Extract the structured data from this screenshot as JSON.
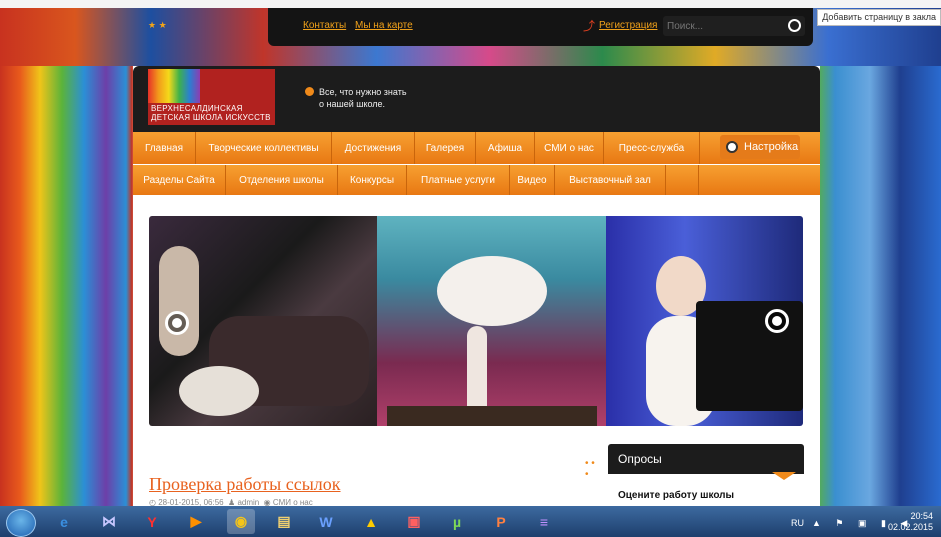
{
  "browser": {
    "bookmark_label": "Добавить страницу в закла"
  },
  "topbar": {
    "links": [
      "Контакты",
      "Мы на карте"
    ],
    "register": "Регистрация",
    "search_placeholder": "Поиск..."
  },
  "header": {
    "logo_line1": "ВЕРХНЕСАЛДИНСКАЯ",
    "logo_line2": "ДЕТСКАЯ ШКОЛА ИСКУССТВ",
    "notice_line1": "Все, что нужно знать",
    "notice_line2": "о нашей школе."
  },
  "nav1": [
    "Главная",
    "Творческие коллективы",
    "Достижения",
    "Галерея",
    "Афиша",
    "СМИ о нас",
    "Пресс-служба"
  ],
  "settings_label": "Настройка",
  "nav2": [
    "Разделы Сайта",
    "Отделения школы",
    "Конкурсы",
    "Платные услуги",
    "Видео",
    "Выставочный зал"
  ],
  "article": {
    "title": "Проверка работы ссылок",
    "date": "28-01-2015, 06:56",
    "author": "admin",
    "category": "СМИ о нас"
  },
  "poll": {
    "title": "Опросы",
    "question": "Оцените работу школы"
  },
  "taskbar": {
    "lang": "RU",
    "time": "20:54",
    "date": "02.02.2015"
  }
}
